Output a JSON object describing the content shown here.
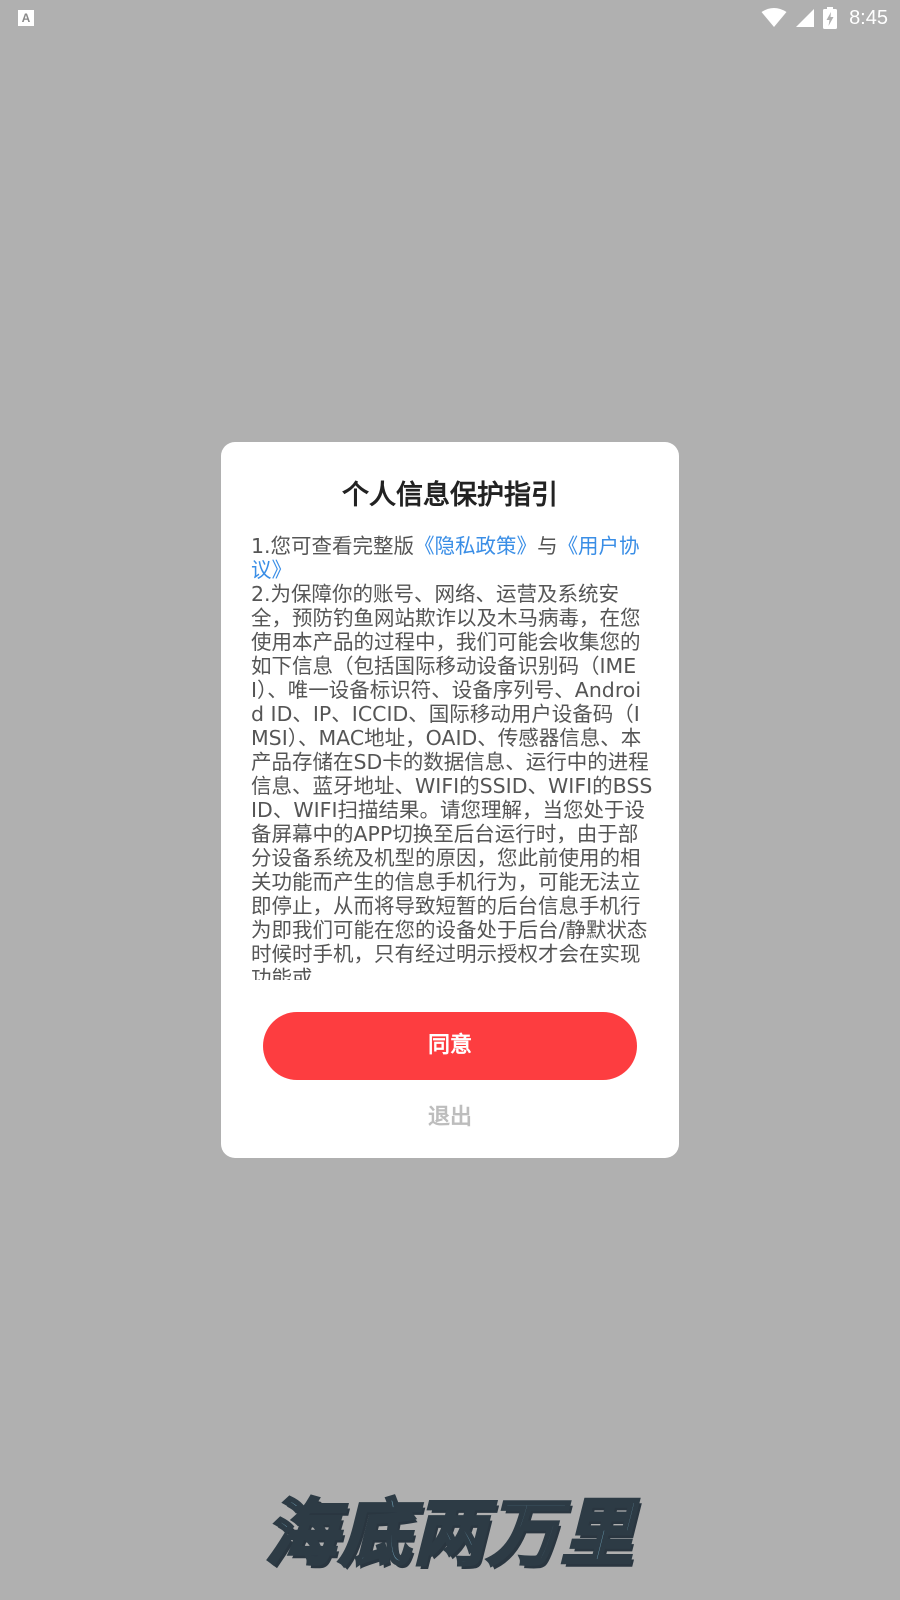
{
  "status_bar": {
    "time": "8:45",
    "left_icon": "A",
    "icons": [
      "wifi-icon",
      "signal-icon",
      "battery-charging-icon"
    ]
  },
  "dialog": {
    "title": "个人信息保护指引",
    "para1_prefix": "1.您可查看完整版",
    "privacy_link": "《隐私政策》",
    "para1_mid": "与",
    "user_agreement_link": "《用户协议》",
    "para2": "2.为保障你的账号、网络、运营及系统安全，预防钓鱼网站欺诈以及木马病毒，在您使用本产品的过程中，我们可能会收集您的如下信息（包括国际移动设备识别码（IMEI）、唯一设备标识符、设备序列号、Android ID、IP、ICCID、国际移动用户设备码（IMSI）、MAC地址，OAID、传感器信息、本产品存储在SD卡的数据信息、运行中的进程信息、蓝牙地址、WIFI的SSID、WIFI的BSSID、WIFI扫描结果。请您理解，当您处于设备屏幕中的APP切换至后台运行时，由于部分设备系统及机型的原因，您此前使用的相关功能而产生的信息手机行为，可能无法立即停止，从而将导致短暂的后台信息手机行为即我们可能在您的设备处于后台/静默状态时候时手机，只有经过明示授权才会在实现功能或",
    "agree_label": "同意",
    "exit_label": "退出"
  },
  "bottom_logo": {
    "text": "海底两万里"
  },
  "colors": {
    "overlay_bg": "#b0b0b0",
    "accent_red": "#fd3d40",
    "link_blue": "#3a8ee6",
    "exit_gray": "#bdbdbd"
  }
}
